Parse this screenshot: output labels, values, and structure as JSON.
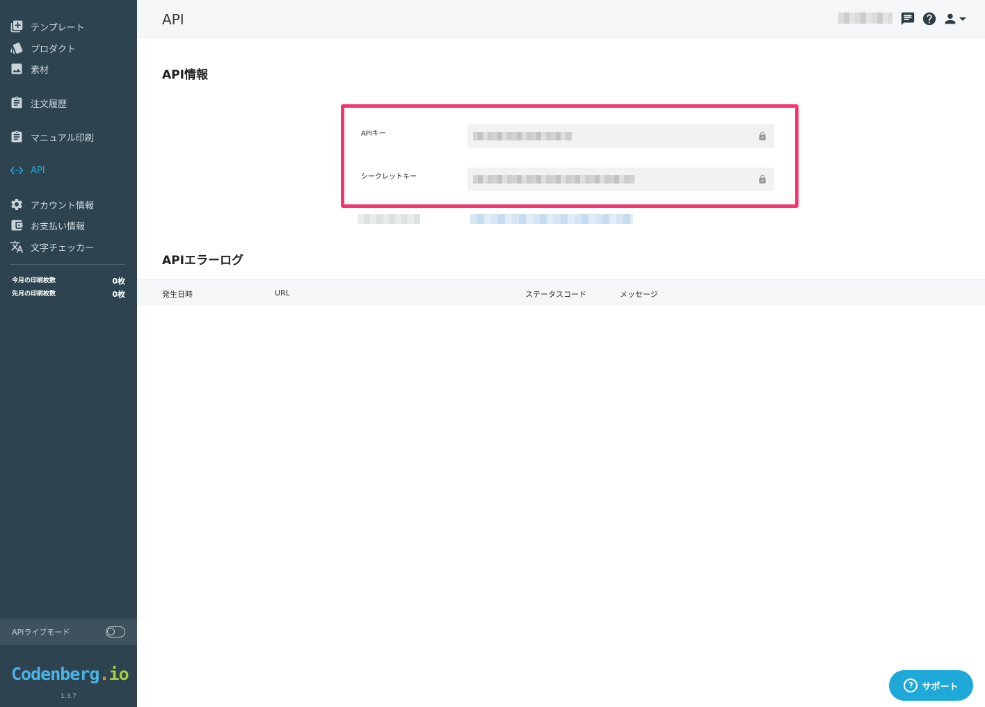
{
  "header": {
    "title": "API"
  },
  "sidebar": {
    "items": [
      {
        "label": "テンプレート",
        "icon": "add-box-icon"
      },
      {
        "label": "プロダクト",
        "icon": "cards-icon"
      },
      {
        "label": "素材",
        "icon": "image-icon"
      },
      {
        "label": "注文履歴",
        "icon": "clipboard-icon"
      },
      {
        "label": "マニュアル印刷",
        "icon": "clipboard-icon"
      },
      {
        "label": "API",
        "icon": "code-icon",
        "active": true
      },
      {
        "label": "アカウント情報",
        "icon": "gear-icon"
      },
      {
        "label": "お支払い情報",
        "icon": "wallet-icon"
      },
      {
        "label": "文字チェッカー",
        "icon": "translate-icon"
      }
    ],
    "counts": [
      {
        "label": "今月の印刷枚数",
        "value": "0枚"
      },
      {
        "label": "先月の印刷枚数",
        "value": "0枚"
      }
    ],
    "live_mode_label": "APIライブモード",
    "live_mode_on": false,
    "logo": {
      "main": "Codenberg",
      "dot": ".",
      "io": "io"
    },
    "version": "1.3.7"
  },
  "api_info": {
    "title": "API情報",
    "api_key_label": "APIキー",
    "secret_key_label": "シークレットキー"
  },
  "error_log": {
    "title": "APIエラーログ",
    "columns": [
      "発生日時",
      "URL",
      "ステータスコード",
      "メッセージ"
    ]
  },
  "support": {
    "label": "サポート"
  },
  "colors": {
    "sidebar_bg": "#2d434f",
    "accent": "#2aa7e0",
    "highlight": "#f4376f",
    "support_bg": "#1fa9d9"
  }
}
